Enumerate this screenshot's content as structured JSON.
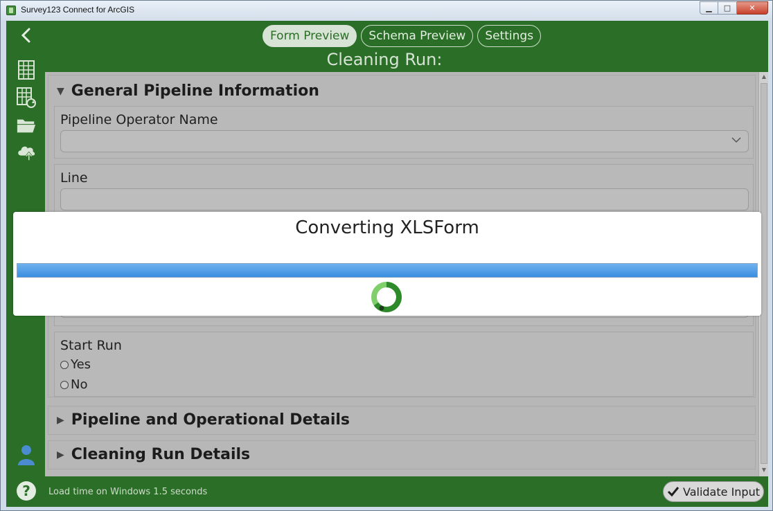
{
  "window": {
    "title": "Survey123 Connect for ArcGIS",
    "min_glyph": "▁",
    "max_glyph": "□",
    "close_glyph": "✕"
  },
  "tabs": [
    {
      "label": "Form Preview",
      "active": true
    },
    {
      "label": "Schema Preview",
      "active": false
    },
    {
      "label": "Settings",
      "active": false
    }
  ],
  "form": {
    "title": "Cleaning Run:",
    "groups": [
      {
        "label": "General Pipeline Information",
        "expanded": true
      },
      {
        "label": "Pipeline and Operational Details",
        "expanded": false
      },
      {
        "label": "Cleaning Run Details",
        "expanded": false
      }
    ],
    "questions": {
      "operator": {
        "label": "Pipeline Operator Name",
        "value": ""
      },
      "line": {
        "label": "Line",
        "value": ""
      },
      "start_run": {
        "label": "Start Run",
        "options": [
          "Yes",
          "No"
        ]
      }
    }
  },
  "footer": {
    "status": "Load time on Windows 1.5 seconds",
    "validate_label": "Validate Input"
  },
  "modal": {
    "title": "Converting XLSForm",
    "progress": 1.0
  },
  "colors": {
    "accent_green": "#2a6e27",
    "progress_blue": "#3a8ee0"
  }
}
